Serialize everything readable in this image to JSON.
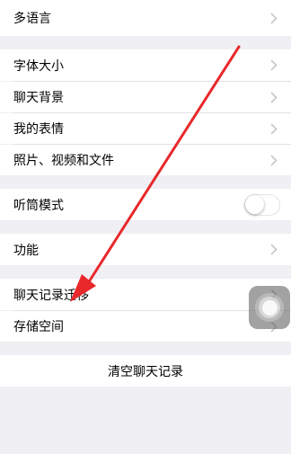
{
  "settings": {
    "language": "多语言",
    "font_size": "字体大小",
    "chat_background": "聊天背景",
    "my_stickers": "我的表情",
    "photos_videos_files": "照片、视频和文件",
    "earpiece_mode": "听筒模式",
    "earpiece_mode_on": false,
    "features": "功能",
    "chat_history_migration": "聊天记录迁移",
    "storage_space": "存储空间",
    "clear_chat_history": "清空聊天记录"
  },
  "icons": {
    "chevron": "chevron-right-icon",
    "annotation_arrow": "red-arrow-icon",
    "assistive_touch": "assistive-touch-icon"
  },
  "colors": {
    "background": "#efeff4",
    "arrow": "#e8282b",
    "chevron": "#c7c7cc"
  }
}
